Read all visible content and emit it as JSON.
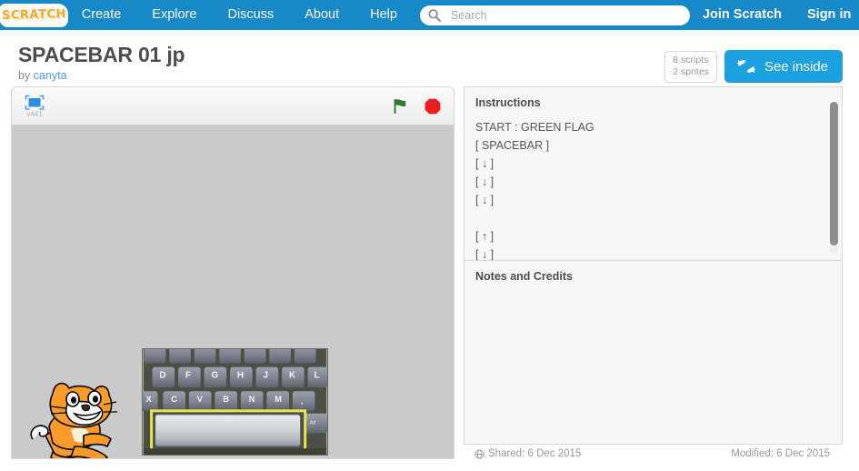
{
  "nav": {
    "logo_text": "SCRATCH",
    "links": [
      {
        "label": "Create"
      },
      {
        "label": "Explore"
      },
      {
        "label": "Discuss"
      },
      {
        "label": "About"
      },
      {
        "label": "Help"
      }
    ],
    "search_placeholder": "Search",
    "search_value": "",
    "search_icon": "search-icon",
    "join_label": "Join Scratch",
    "signin_label": "Sign in",
    "bg_color": "#1789c8"
  },
  "project": {
    "title": "SPACEBAR 01 jp",
    "by_prefix": "by",
    "author": "canyta",
    "stats": {
      "scripts": "8 scripts",
      "sprites": "2 sprites"
    },
    "see_inside_label": "See inside",
    "see_inside_icon": "see-inside-arrows-icon",
    "see_inside_color": "#1ba0e0"
  },
  "player": {
    "fullscreen_icon": "fullscreen-icon",
    "version_label": "v441",
    "green_flag_icon": "green-flag-icon",
    "green_flag_color": "#2e7d32",
    "stop_icon": "stop-sign-icon",
    "stop_color": "#e81f1f",
    "stage_bg_color": "#cacaca",
    "sprites": [
      {
        "name": "scratch-cat-sprite"
      },
      {
        "name": "keyboard-spacebar-photo",
        "highlight_color": "#e8e84a"
      }
    ]
  },
  "instructions": {
    "heading": "Instructions",
    "lines": [
      "START : GREEN FLAG",
      "[ SPACEBAR ]",
      "[ ↓ ]",
      "[ ↓ ]",
      "[ ↓ ]",
      "",
      "[ ↑ ]",
      "[ ↓ ]"
    ],
    "body": "START : GREEN FLAG\n[ SPACEBAR ]\n[ ↓ ]\n[ ↓ ]\n[ ↓ ]\n\n[ ↑ ]\n[ ↓ ]"
  },
  "notes": {
    "heading": "Notes and Credits",
    "body": ""
  },
  "footer": {
    "shared_label": "Shared: 6 Dec 2015",
    "modified_label": "Modified: 6 Dec 2015",
    "shared_icon": "globe-icon"
  }
}
